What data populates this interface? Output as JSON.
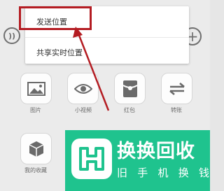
{
  "popup_menu": {
    "items": [
      {
        "label": "发送位置"
      },
      {
        "label": "共享实时位置"
      }
    ]
  },
  "toolbar": {
    "voice_icon": "voice-icon",
    "plus_icon": "plus-icon"
  },
  "apps_grid": {
    "tiles": [
      {
        "label": "图片",
        "icon": "image-icon"
      },
      {
        "label": "小视频",
        "icon": "video-eye-icon"
      },
      {
        "label": "红包",
        "icon": "red-packet-icon"
      },
      {
        "label": "转账",
        "icon": "transfer-icon"
      },
      {
        "label": "我的收藏",
        "icon": "favorites-cube-icon"
      }
    ]
  },
  "watermark": {
    "title": "换换回收",
    "subtitle": [
      "旧",
      "手",
      "机",
      "换",
      "钱"
    ]
  },
  "colors": {
    "highlight": "#b41c22",
    "banner": "#1fc38e"
  }
}
